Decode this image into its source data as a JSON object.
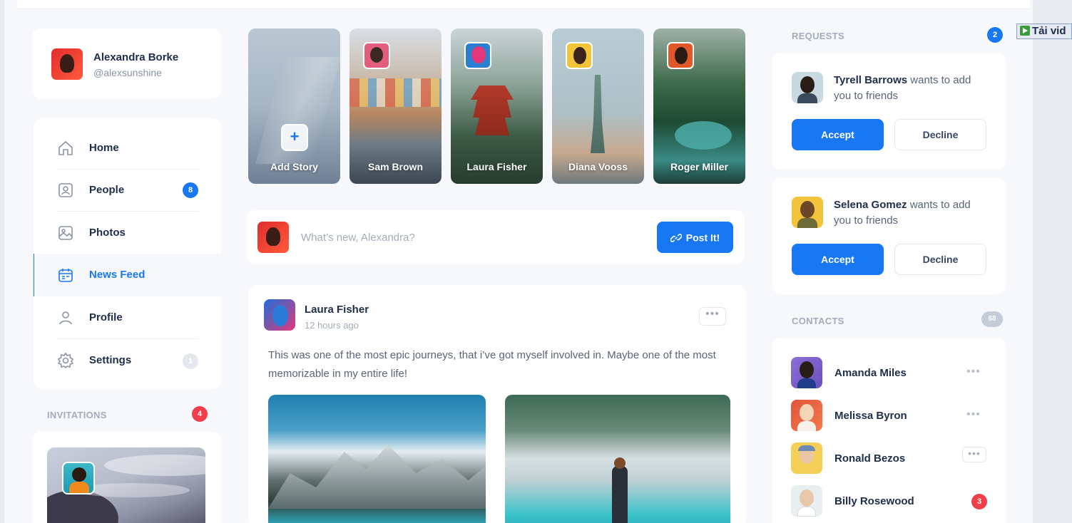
{
  "profile": {
    "name": "Alexandra Borke",
    "handle": "@alexsunshine"
  },
  "nav": {
    "items": [
      {
        "label": "Home",
        "icon": "home-icon"
      },
      {
        "label": "People",
        "icon": "people-icon",
        "badge": "8"
      },
      {
        "label": "Photos",
        "icon": "photos-icon"
      },
      {
        "label": "News Feed",
        "icon": "news-feed-icon",
        "active": true
      },
      {
        "label": "Profile",
        "icon": "profile-icon"
      },
      {
        "label": "Settings",
        "icon": "settings-icon",
        "badge": "1"
      }
    ]
  },
  "invitations": {
    "title": "INVITATIONS",
    "count": "4"
  },
  "stories": [
    {
      "label": "Add Story"
    },
    {
      "label": "Sam Brown"
    },
    {
      "label": "Laura Fisher"
    },
    {
      "label": "Diana Vooss"
    },
    {
      "label": "Roger Miller"
    }
  ],
  "composer": {
    "placeholder": "What’s new, Alexandra?",
    "button": "Post It!"
  },
  "post": {
    "author": "Laura Fisher",
    "time": "12 hours ago",
    "text": "This was one of the most epic journeys, that i’ve got myself involved in. Maybe one of the most memorizable in my entire life!"
  },
  "requests": {
    "title": "REQUESTS",
    "count": "2",
    "items": [
      {
        "name": "Tyrell Barrows",
        "text": " wants to add you to friends",
        "accept": "Accept",
        "decline": "Decline"
      },
      {
        "name": "Selena Gomez",
        "text": " wants to add you to friends",
        "accept": "Accept",
        "decline": "Decline"
      }
    ]
  },
  "contacts": {
    "title": "CONTACTS",
    "count": "68",
    "items": [
      {
        "name": "Amanda Miles"
      },
      {
        "name": "Melissa Byron"
      },
      {
        "name": "Ronald Bezos"
      },
      {
        "name": "Billy Rosewood",
        "badge": "3"
      }
    ]
  },
  "overlay": {
    "label": "Tải vid"
  },
  "colors": {
    "accent": "#1877f2",
    "badge_red": "#f03e4a",
    "background": "#f6f8fb"
  }
}
